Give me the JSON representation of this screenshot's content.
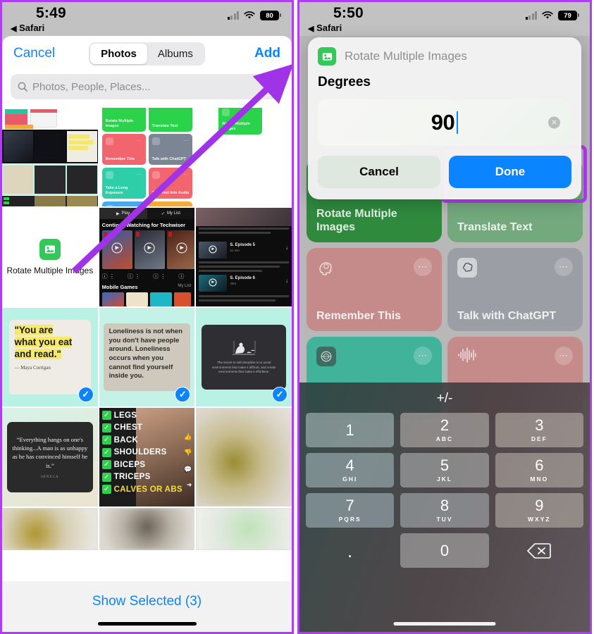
{
  "left_phone": {
    "status_bar": {
      "time": "5:49",
      "back_app": "Safari",
      "battery": "80",
      "wifi_icon": "wifi-icon",
      "signal_icon": "cellular-signal-icon"
    },
    "picker": {
      "cancel_label": "Cancel",
      "add_label": "Add",
      "tabs": [
        {
          "label": "Photos",
          "selected": true
        },
        {
          "label": "Albums",
          "selected": false
        }
      ],
      "search_placeholder": "Photos, People, Places...",
      "search_icon": "search-icon",
      "mic_icon": "microphone-icon",
      "show_selected_label": "Show Selected (3)",
      "selected_count": 3,
      "photos": [
        {
          "id": "p1",
          "type": "screenshot-collage",
          "selected": false
        },
        {
          "id": "p2",
          "type": "shortcuts-grid",
          "selected": false
        },
        {
          "id": "p3",
          "type": "shortcut-single",
          "selected": false
        },
        {
          "id": "p4",
          "type": "rotate-multiple-images",
          "label": "Rotate Multiple Images",
          "selected": false
        },
        {
          "id": "p5",
          "type": "netflix-home",
          "selected": false
        },
        {
          "id": "p6",
          "type": "netflix-episodes",
          "selected": false
        },
        {
          "id": "p7",
          "type": "quote-you-are",
          "selected": true
        },
        {
          "id": "p8",
          "type": "quote-loneliness",
          "selected": true
        },
        {
          "id": "p9",
          "type": "quote-discipline",
          "selected": true
        },
        {
          "id": "p10",
          "type": "quote-seneca",
          "selected": false
        },
        {
          "id": "p11",
          "type": "gym-checklist",
          "selected": false
        },
        {
          "id": "p12",
          "type": "blurred-food",
          "selected": false
        },
        {
          "id": "p13",
          "type": "blurred-1",
          "selected": false
        },
        {
          "id": "p14",
          "type": "blurred-2",
          "selected": false
        },
        {
          "id": "p15",
          "type": "blurred-3",
          "selected": false
        }
      ],
      "photo_text": {
        "quote_you_are_lines": [
          "\"You are",
          "what you eat",
          "and read.\""
        ],
        "quote_you_are_author": "— Maya Corrigan",
        "quote_loneliness": "Loneliness is not when you don't have people around. Loneliness occurs when you cannot find yourself inside you.",
        "quote_discipline": "The secret to self-discipline is to avoid environments that make it difficult, and create environments that make it effortless.",
        "quote_seneca": "“Everything hangs on one's thinking...A man is as unhappy as he has convinced himself he is.”",
        "quote_seneca_author": "SENECA",
        "gym_items": [
          "LEGS",
          "CHEST",
          "BACK",
          "SHOULDERS",
          "BICEPS",
          "TRICEPS",
          "CALVES OR ABS"
        ],
        "netflix_tabs": [
          "Play",
          "My List"
        ],
        "netflix_row1": "Continue Watching for Techwiser",
        "netflix_row2": "Mobile Games",
        "netflix_row2_right": "My List",
        "netflix_episode1": "S. Episode 5",
        "netflix_episode2": "S. Episode 6",
        "mini_shortcut_labels": [
          "Rotate Multiple Images",
          "Translate Text",
          "Remember This",
          "Talk with ChatGPT",
          "Take a Long Exposure",
          "Turn Text Into Audio"
        ]
      }
    }
  },
  "right_phone": {
    "status_bar": {
      "time": "5:50",
      "back_app": "Safari",
      "battery": "79",
      "wifi_icon": "wifi-icon",
      "signal_icon": "cellular-signal-icon"
    },
    "dialog": {
      "app_icon": "photos-shortcut-icon",
      "app_name": "Rotate Multiple Images",
      "field_title": "Degrees",
      "field_value": "90",
      "clear_icon": "clear-circle-icon",
      "cancel_label": "Cancel",
      "done_label": "Done"
    },
    "shortcuts": [
      {
        "label": "Rotate Multiple Images",
        "color": "#2f8a3e",
        "icon": "photos-icon"
      },
      {
        "label": "Translate Text",
        "color": "#73a97d",
        "icon": "translate-icon"
      },
      {
        "label": "Remember This",
        "color": "#c58b8b",
        "icon": "brain-head-icon"
      },
      {
        "label": "Talk with ChatGPT",
        "color": "#9b9ea4",
        "icon": "chatgpt-icon"
      },
      {
        "label": "",
        "color": "#42b39b",
        "icon": "long-exposure-icon"
      },
      {
        "label": "",
        "color": "#c58b8b",
        "icon": "audio-waveform-icon"
      }
    ],
    "keyboard": {
      "plus_minus": "+/-",
      "keys": [
        {
          "num": "1",
          "sub": ""
        },
        {
          "num": "2",
          "sub": "ABC"
        },
        {
          "num": "3",
          "sub": "DEF"
        },
        {
          "num": "4",
          "sub": "GHI"
        },
        {
          "num": "5",
          "sub": "JKL"
        },
        {
          "num": "6",
          "sub": "MNO"
        },
        {
          "num": "7",
          "sub": "PQRS"
        },
        {
          "num": "8",
          "sub": "TUV"
        },
        {
          "num": "9",
          "sub": "WXYZ"
        },
        {
          "num": ".",
          "sub": ""
        },
        {
          "num": "0",
          "sub": ""
        }
      ],
      "delete_icon": "backspace-icon"
    }
  },
  "annotations": {
    "arrow_color": "#a033e8",
    "highlight_color": "#b13df0",
    "arrow_target": "Add button",
    "highlight_target": "Done button"
  }
}
